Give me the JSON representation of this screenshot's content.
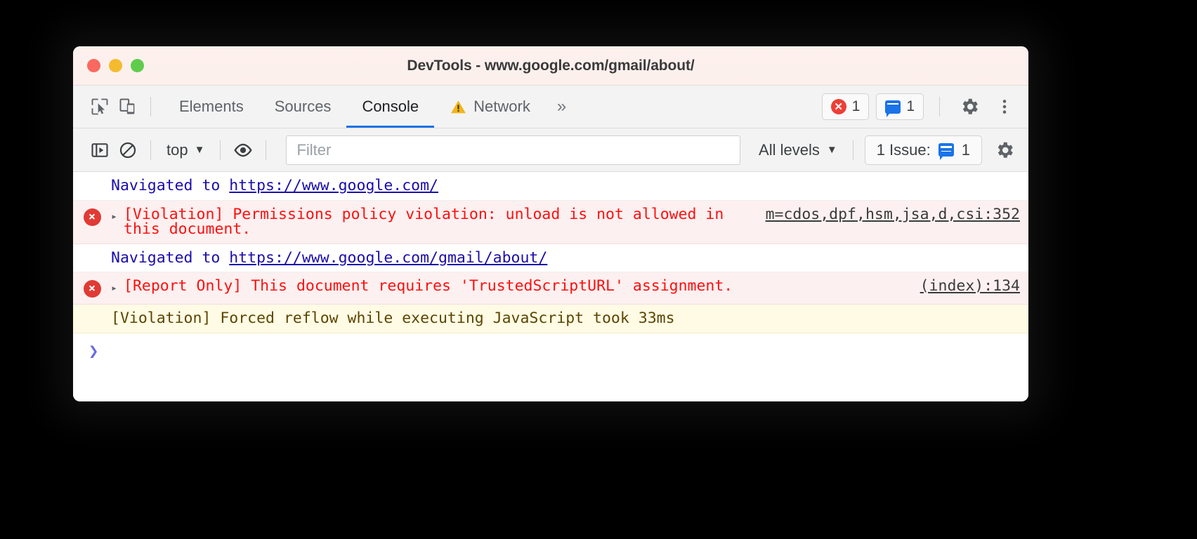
{
  "window": {
    "title": "DevTools - www.google.com/gmail/about/",
    "traffic_lights": [
      {
        "name": "close",
        "color": "#f9695f"
      },
      {
        "name": "minimize",
        "color": "#f5bb2f"
      },
      {
        "name": "maximize",
        "color": "#5fcc4c"
      }
    ]
  },
  "tabbar": {
    "inspect_icon": "inspect-cursor-icon",
    "device_icon": "device-toolbar-icon",
    "tabs": [
      {
        "label": "Elements",
        "active": false,
        "warning": false
      },
      {
        "label": "Sources",
        "active": false,
        "warning": false
      },
      {
        "label": "Console",
        "active": true,
        "warning": false
      },
      {
        "label": "Network",
        "active": false,
        "warning": true
      }
    ],
    "more_tabs": "»",
    "error_count": "1",
    "issue_count": "1",
    "settings_icon": "gear-icon",
    "menu_icon": "kebab-menu-icon"
  },
  "filterbar": {
    "sidebar_icon": "console-sidebar-icon",
    "clear_icon": "clear-console-icon",
    "context": "top",
    "context_caret": "▼",
    "eye_icon": "live-expression-eye-icon",
    "filter_placeholder": "Filter",
    "filter_value": "",
    "levels_label": "All levels",
    "levels_caret": "▼",
    "issues_label": "1 Issue:",
    "issues_count": "1",
    "settings_icon": "console-settings-gear-icon"
  },
  "console": {
    "rows": [
      {
        "type": "nav",
        "prefix": "Navigated to ",
        "link": "https://www.google.com/",
        "source": ""
      },
      {
        "type": "error",
        "badge": "×",
        "disclosure": "▸",
        "text": "[Violation] Permissions policy violation: unload is not allowed in this document.",
        "source": "m=cdos,dpf,hsm,jsa,d,csi:352"
      },
      {
        "type": "nav",
        "prefix": "Navigated to ",
        "link": "https://www.google.com/gmail/about/",
        "source": ""
      },
      {
        "type": "error",
        "badge": "×",
        "disclosure": "▸",
        "text": "[Report Only] This document requires 'TrustedScriptURL' assignment.",
        "source": "(index):134"
      },
      {
        "type": "warn",
        "badge": "",
        "disclosure": "",
        "text": "[Violation] Forced reflow while executing JavaScript took 33ms",
        "source": ""
      }
    ],
    "prompt_caret": "❯"
  },
  "colors": {
    "accent": "#1a73e8",
    "error_bg": "#fdf0f0",
    "error_text": "#ff0f0f",
    "warn_bg": "#fffbe5",
    "warn_text": "#5c4500",
    "link": "#1a0dab",
    "titlebar_bg": "#fdf1ee"
  }
}
